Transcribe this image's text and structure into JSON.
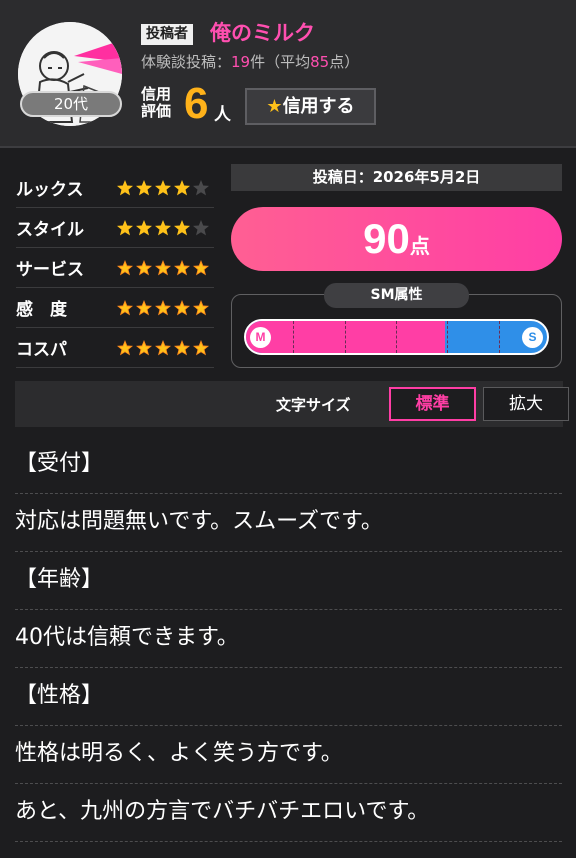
{
  "profile": {
    "age_badge": "20代",
    "poster_tag": "投稿者",
    "poster_name": "俺のミルク",
    "post_count_prefix": "体験談投稿：",
    "post_count": "19",
    "post_count_mid": "件（平均",
    "post_avg": "85",
    "post_count_suffix": "点）",
    "trust_label": "信用評価",
    "trust_count": "6",
    "trust_unit": "人",
    "trust_button_star": "★",
    "trust_button_label": "信用する"
  },
  "ratings": [
    {
      "label": "ルックス",
      "stars": 4
    },
    {
      "label": "スタイル",
      "stars": 4
    },
    {
      "label": "サービス",
      "stars": 5
    },
    {
      "label": "感　度",
      "stars": 5
    },
    {
      "label": "コスパ",
      "stars": 5
    }
  ],
  "post_date": "投稿日：2026年5月2日",
  "score": {
    "value": "90",
    "unit": "点"
  },
  "sm": {
    "title": "SM属性",
    "m_label": "M",
    "s_label": "S",
    "m_fraction": 0.66
  },
  "font_size": {
    "label": "文字サイズ",
    "standard": "標準",
    "large": "拡大"
  },
  "body_lines": [
    "【受付】",
    "対応は問題無いです。スムーズです。",
    "【年齢】",
    "40代は信頼できます。",
    "【性格】",
    "性格は明るく、よく笑う方です。",
    "あと、九州の方言でバチバチエロいです。"
  ],
  "colors": {
    "accent_pink": "#ff3ea5",
    "star_gold": "#ffc21a",
    "trust_orange": "#ffb21a",
    "s_blue": "#2f8fe8"
  }
}
